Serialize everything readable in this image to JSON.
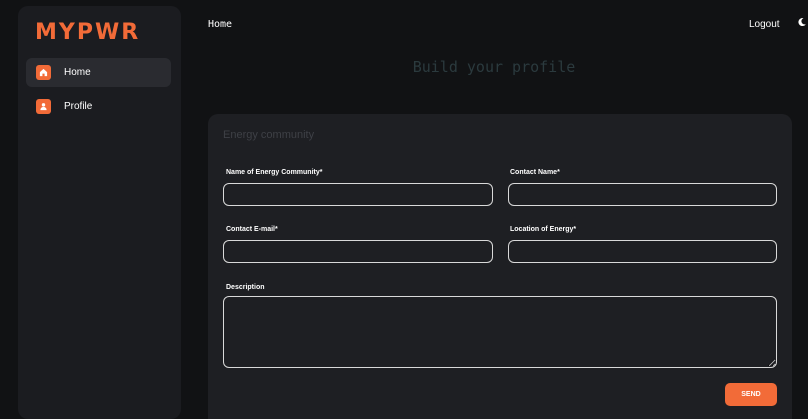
{
  "sidebar": {
    "logo": "MYPWR",
    "items": [
      {
        "label": "Home",
        "icon": "home-icon",
        "active": true
      },
      {
        "label": "Profile",
        "icon": "user-icon",
        "active": false
      }
    ]
  },
  "topbar": {
    "title": "Home",
    "logout_label": "Logout",
    "theme_icon": "moon-icon"
  },
  "main": {
    "heading": "Build your profile",
    "card": {
      "title": "Energy community",
      "fields": {
        "community_name": {
          "label": "Name of Energy Community*",
          "value": ""
        },
        "contact_name": {
          "label": "Contact Name*",
          "value": ""
        },
        "contact_email": {
          "label": "Contact E-mail*",
          "value": ""
        },
        "location": {
          "label": "Location of Energy*",
          "value": ""
        },
        "description": {
          "label": "Description",
          "value": ""
        }
      },
      "send_label": "SEND"
    }
  },
  "colors": {
    "accent": "#f26b38",
    "background": "#111214",
    "panel": "#1e1f23"
  }
}
